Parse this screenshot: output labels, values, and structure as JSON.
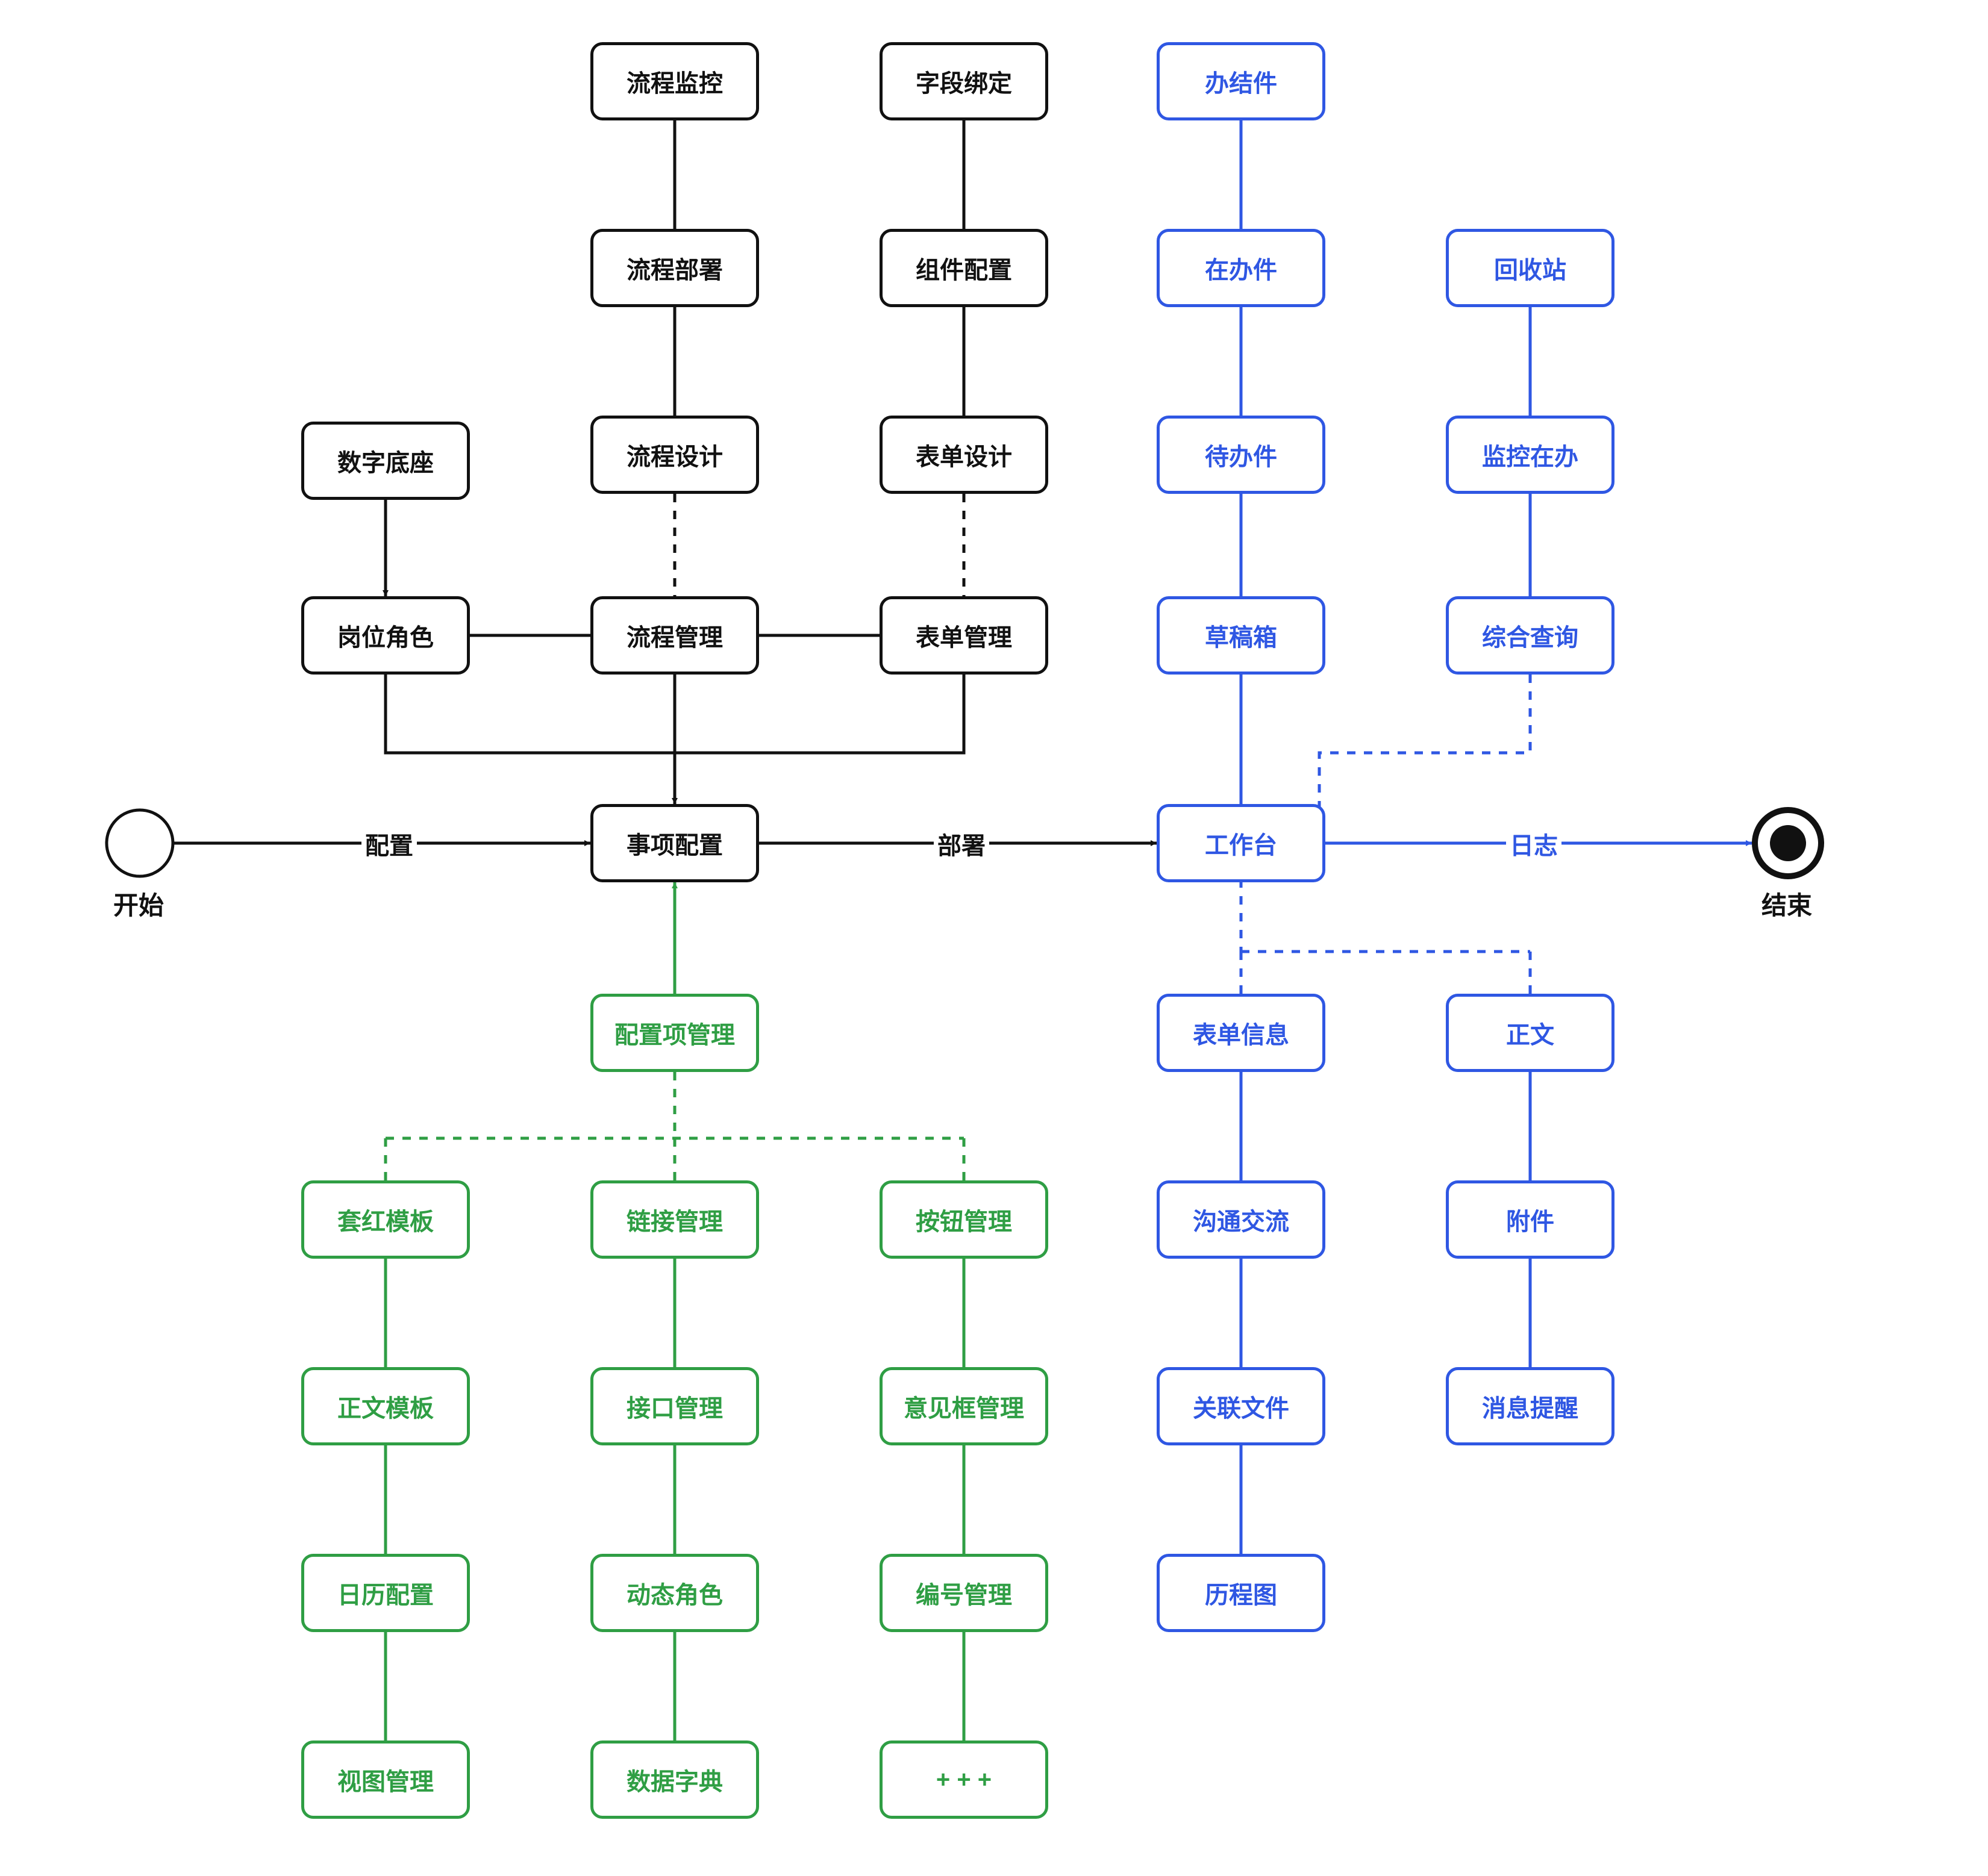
{
  "diagram": {
    "terminals": {
      "start": "开始",
      "end": "结束"
    },
    "edge_labels": {
      "configure": "配置",
      "deploy": "部署",
      "log": "日志"
    },
    "nodes": {
      "digital_base": "数字底座",
      "post_role": "岗位角色",
      "process_monitor": "流程监控",
      "process_deploy": "流程部署",
      "process_design": "流程设计",
      "process_manage": "流程管理",
      "field_bind": "字段绑定",
      "component_config": "组件配置",
      "form_design": "表单设计",
      "form_manage": "表单管理",
      "item_config": "事项配置",
      "config_item_manage": "配置项管理",
      "red_template": "套红模板",
      "body_template": "正文模板",
      "calendar_config": "日历配置",
      "view_manage": "视图管理",
      "link_manage": "链接管理",
      "interface_manage": "接口管理",
      "dynamic_role": "动态角色",
      "data_dict": "数据字典",
      "button_manage": "按钮管理",
      "opinion_box_manage": "意见框管理",
      "number_manage": "编号管理",
      "more": "+ + +",
      "completed": "办结件",
      "in_progress": "在办件",
      "todo": "待办件",
      "draft_box": "草稿箱",
      "recycle_bin": "回收站",
      "monitor_pending": "监控在办",
      "comprehensive_query": "综合查询",
      "workbench": "工作台",
      "form_info": "表单信息",
      "communication": "沟通交流",
      "related_files": "关联文件",
      "history_chart": "历程图",
      "main_text": "正文",
      "attachment": "附件",
      "message_reminder": "消息提醒"
    }
  }
}
